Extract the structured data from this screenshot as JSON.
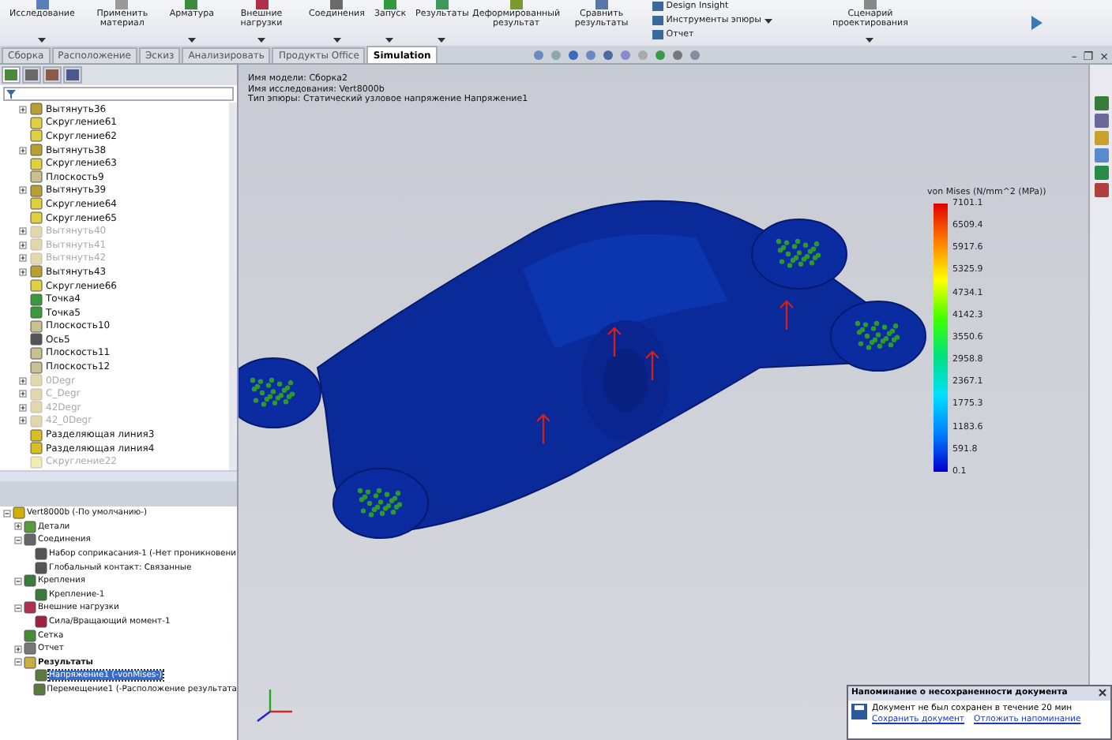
{
  "ribbon": {
    "buttons": [
      {
        "label": "Исследование",
        "menu": true
      },
      {
        "label": "Применить материал",
        "menu": false
      },
      {
        "label": "Арматура",
        "menu": true
      },
      {
        "label": "Внешние нагрузки",
        "menu": true
      },
      {
        "label": "Соединения",
        "menu": true
      },
      {
        "label": "Запуск",
        "menu": true
      },
      {
        "label": "Результаты",
        "menu": true
      },
      {
        "label": "Деформированный результат",
        "menu": false
      },
      {
        "label": "Сравнить результаты",
        "menu": false
      }
    ],
    "small_buttons": [
      {
        "label": "Design Insight",
        "menu": false
      },
      {
        "label": "Инструменты эпюры",
        "menu": true
      },
      {
        "label": "Отчет",
        "menu": false
      }
    ],
    "scenario_button": {
      "label": "Сценарий проектирования",
      "menu": true
    }
  },
  "tabs": [
    {
      "label": "Сборка",
      "selected": false
    },
    {
      "label": "Расположение",
      "selected": false
    },
    {
      "label": "Эскиз",
      "selected": false
    },
    {
      "label": "Анализировать",
      "selected": false
    },
    {
      "label": "Продукты Office",
      "selected": false
    },
    {
      "label": "Simulation",
      "selected": true
    }
  ],
  "window_controls": [
    "–",
    "❐",
    "×"
  ],
  "panel_tabs": [
    {
      "selected": true
    },
    {
      "selected": false
    },
    {
      "selected": false
    },
    {
      "selected": false
    }
  ],
  "feature_tree": [
    {
      "label": "Вытянуть36",
      "kind": "extrude",
      "expandable": true,
      "suppressed": false
    },
    {
      "label": "Скругление61",
      "kind": "fillet",
      "expandable": false,
      "suppressed": false
    },
    {
      "label": "Скругление62",
      "kind": "fillet",
      "expandable": false,
      "suppressed": false
    },
    {
      "label": "Вытянуть38",
      "kind": "extrude",
      "expandable": true,
      "suppressed": false
    },
    {
      "label": "Скругление63",
      "kind": "fillet",
      "expandable": false,
      "suppressed": false
    },
    {
      "label": "Плоскость9",
      "kind": "plane",
      "expandable": false,
      "suppressed": false
    },
    {
      "label": "Вытянуть39",
      "kind": "extrude",
      "expandable": true,
      "suppressed": false
    },
    {
      "label": "Скругление64",
      "kind": "fillet",
      "expandable": false,
      "suppressed": false
    },
    {
      "label": "Скругление65",
      "kind": "fillet",
      "expandable": false,
      "suppressed": false
    },
    {
      "label": "Вытянуть40",
      "kind": "extrude",
      "expandable": true,
      "suppressed": true
    },
    {
      "label": "Вытянуть41",
      "kind": "extrude",
      "expandable": true,
      "suppressed": true
    },
    {
      "label": "Вытянуть42",
      "kind": "extrude",
      "expandable": true,
      "suppressed": true
    },
    {
      "label": "Вытянуть43",
      "kind": "extrude",
      "expandable": true,
      "suppressed": false
    },
    {
      "label": "Скругление66",
      "kind": "fillet",
      "expandable": false,
      "suppressed": false
    },
    {
      "label": "Точка4",
      "kind": "point",
      "expandable": false,
      "suppressed": false
    },
    {
      "label": "Точка5",
      "kind": "point",
      "expandable": false,
      "suppressed": false
    },
    {
      "label": "Плоскость10",
      "kind": "plane",
      "expandable": false,
      "suppressed": false
    },
    {
      "label": "Ось5",
      "kind": "axis",
      "expandable": false,
      "suppressed": false
    },
    {
      "label": "Плоскость11",
      "kind": "plane",
      "expandable": false,
      "suppressed": false
    },
    {
      "label": "Плоскость12",
      "kind": "plane",
      "expandable": false,
      "suppressed": false
    },
    {
      "label": "0Degr",
      "kind": "extrude",
      "expandable": true,
      "suppressed": true
    },
    {
      "label": "C_Degr",
      "kind": "extrude",
      "expandable": true,
      "suppressed": true
    },
    {
      "label": "42Degr",
      "kind": "extrude",
      "expandable": true,
      "suppressed": true
    },
    {
      "label": "42_0Degr",
      "kind": "extrude",
      "expandable": true,
      "suppressed": true
    },
    {
      "label": "Разделяющая линия3",
      "kind": "split",
      "expandable": false,
      "suppressed": false
    },
    {
      "label": "Разделяющая линия4",
      "kind": "split",
      "expandable": false,
      "suppressed": false
    },
    {
      "label": "Скругление22",
      "kind": "fillet",
      "expandable": false,
      "suppressed": true
    }
  ],
  "study_tree": [
    {
      "label": "Vert8000b (-По умолчанию-)",
      "kind": "study",
      "expanded": true,
      "bold": false,
      "selected": false,
      "children": [
        {
          "label": "Детали",
          "kind": "parts",
          "expanded": false,
          "bold": false,
          "selected": false
        },
        {
          "label": "Соединения",
          "kind": "connections",
          "expanded": true,
          "bold": false,
          "selected": false,
          "children": [
            {
              "label": "Набор соприкасания-1 (-Нет проникновени",
              "kind": "contact",
              "bold": false,
              "selected": false
            },
            {
              "label": "Глобальный контакт: Связанные",
              "kind": "contact",
              "bold": false,
              "selected": false
            }
          ]
        },
        {
          "label": "Крепления",
          "kind": "fixtures",
          "expanded": true,
          "bold": false,
          "selected": false,
          "children": [
            {
              "label": "Крепление-1",
              "kind": "fixture",
              "bold": false,
              "selected": false
            }
          ]
        },
        {
          "label": "Внешние нагрузки",
          "kind": "loads",
          "expanded": true,
          "bold": false,
          "selected": false,
          "children": [
            {
              "label": "Сила/Вращающий момент-1",
              "kind": "force",
              "bold": false,
              "selected": false
            }
          ]
        },
        {
          "label": "Сетка",
          "kind": "mesh",
          "bold": false,
          "selected": false
        },
        {
          "label": "Отчет",
          "kind": "report",
          "expanded": false,
          "bold": false,
          "selected": false
        },
        {
          "label": "Результаты",
          "kind": "results",
          "expanded": true,
          "bold": true,
          "selected": false,
          "children": [
            {
              "label": "Напряжение1 (-vonMises-)",
              "kind": "plot",
              "bold": false,
              "selected": true
            },
            {
              "label": "Перемещение1 (-Расположение результата",
              "kind": "plot",
              "bold": false,
              "selected": false
            }
          ]
        }
      ]
    }
  ],
  "viewport": {
    "info": [
      "Имя модели: Сборка2",
      "Имя исследования: Vert8000b",
      "Тип эпюры: Статический узловое напряжение Напряжение1"
    ],
    "legend": {
      "title": "von Mises (N/mm^2 (MPa))",
      "ticks": [
        "7101.1",
        "6509.4",
        "5917.6",
        "5325.9",
        "4734.1",
        "4142.3",
        "3550.6",
        "2958.8",
        "2367.1",
        "1775.3",
        "1183.6",
        "591.8",
        "0.1"
      ]
    }
  },
  "notification": {
    "title": "Напоминание о несохраненности документа",
    "message": "Документ не был сохранен в течение 20 мин",
    "links": [
      "Сохранить документ",
      "Отложить напоминание"
    ]
  }
}
